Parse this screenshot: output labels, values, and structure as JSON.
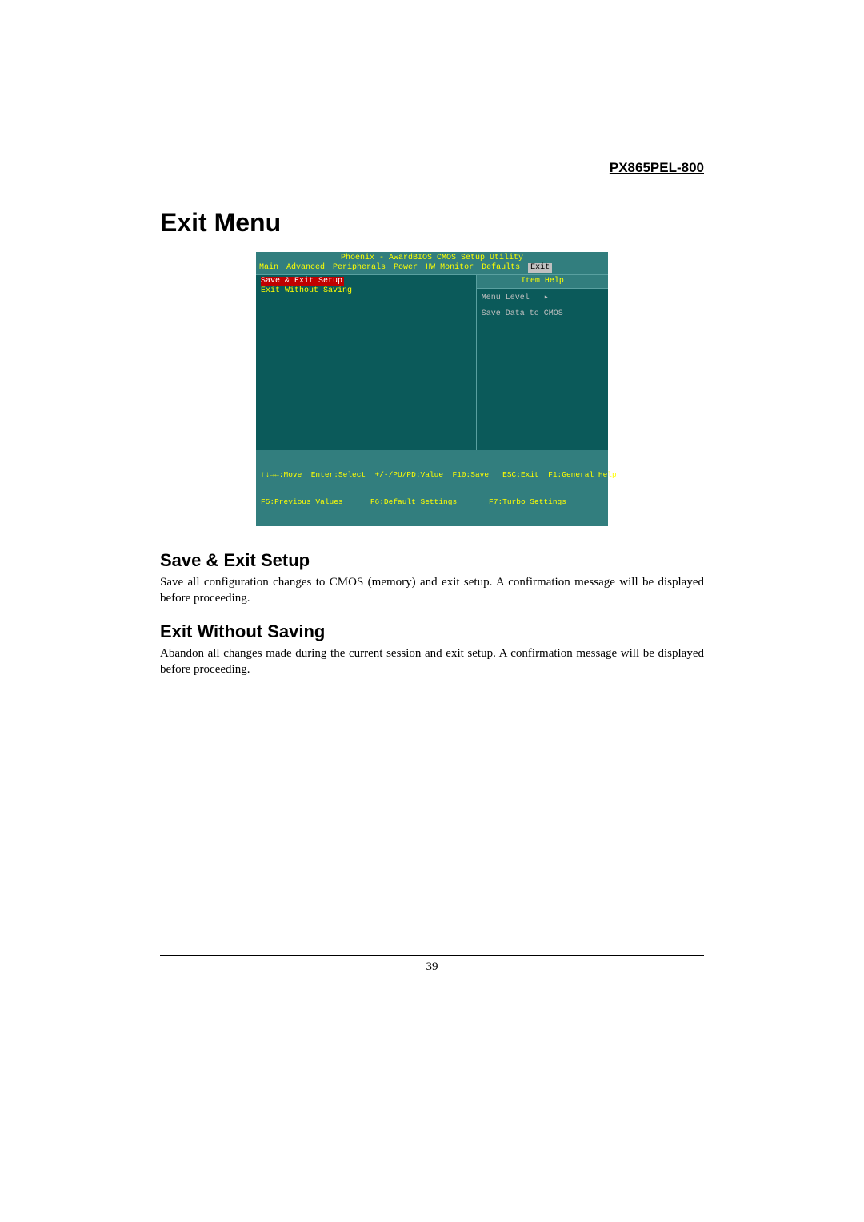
{
  "product_name": "PX865PEL-800",
  "main_title": "Exit Menu",
  "bios": {
    "title": "Phoenix - AwardBIOS CMOS Setup Utility",
    "tabs": [
      "Main",
      "Advanced",
      "Peripherals",
      "Power",
      "HW Monitor",
      "Defaults",
      "Exit"
    ],
    "active_tab": "Exit",
    "left_items": [
      "Save & Exit Setup",
      "Exit Without Saving"
    ],
    "help_header": "Item Help",
    "help_lines": [
      "Menu Level   ▸",
      "Save Data to CMOS"
    ],
    "footer_line1": "↑↓→←:Move  Enter:Select  +/-/PU/PD:Value  F10:Save   ESC:Exit  F1:General Help",
    "footer_line2": "F5:Previous Values      F6:Default Settings       F7:Turbo Settings"
  },
  "sections": [
    {
      "heading": "Save & Exit Setup",
      "body": "Save all configuration changes to CMOS (memory) and exit setup. A confirmation message will be displayed before proceeding."
    },
    {
      "heading": "Exit Without Saving",
      "body": "Abandon all changes made during the current session and exit setup. A confirmation message will be displayed before proceeding."
    }
  ],
  "page_number": "39"
}
